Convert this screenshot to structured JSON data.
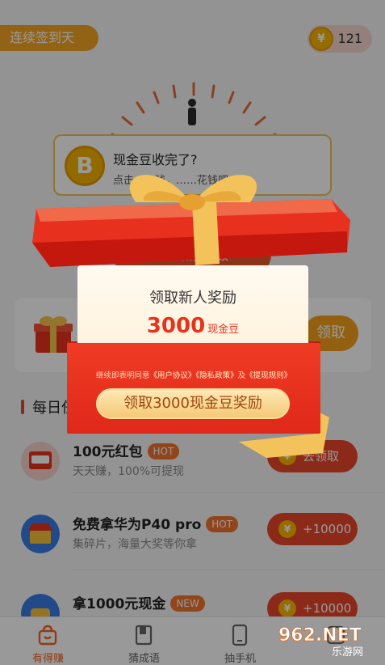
{
  "header": {
    "streak_label": "连续签到天",
    "coin_count": "121",
    "coin_symbol": "¥"
  },
  "tooltip": {
    "title": "现金豆收完了?",
    "subtitle": "点击……钱，……花钱吧～",
    "coin_letter": "B"
  },
  "sync_button": "同步微信步数",
  "reward_card": {
    "claim_label": "领取"
  },
  "section": {
    "title": "每日任务"
  },
  "tasks": [
    {
      "title": "100元红包",
      "badge": "HOT",
      "subtitle": "天天赚，100%可提现",
      "action": "去领取"
    },
    {
      "title": "免费拿华为P40 pro",
      "badge": "HOT",
      "subtitle": "集碎片，海量大奖等你拿",
      "action": "+10000"
    },
    {
      "title": "拿1000元现金",
      "badge": "NEW",
      "subtitle": "",
      "action": "+10000"
    }
  ],
  "tabbar": [
    {
      "label": "有得赚",
      "icon": "gift-bag-icon",
      "active": true
    },
    {
      "label": "猜成语",
      "icon": "book-icon",
      "active": false
    },
    {
      "label": "抽手机",
      "icon": "phone-icon",
      "active": false
    },
    {
      "label": "",
      "icon": "more-icon",
      "active": false
    }
  ],
  "modal": {
    "title": "领取新人奖励",
    "amount": "3000",
    "unit": "现金豆",
    "agree_prefix": "继续即表明同意",
    "agree_link1": "《用户协议》",
    "agree_link2": "《隐私政策》",
    "agree_mid": "及",
    "agree_link3": "《提现规则》",
    "button": "领取3000现金豆奖励"
  },
  "watermark": {
    "text": "962.NET",
    "sub": "乐游网"
  },
  "colors": {
    "accent": "#e8462a",
    "gold": "#f5b100",
    "ribbon": "#f3c25b"
  }
}
